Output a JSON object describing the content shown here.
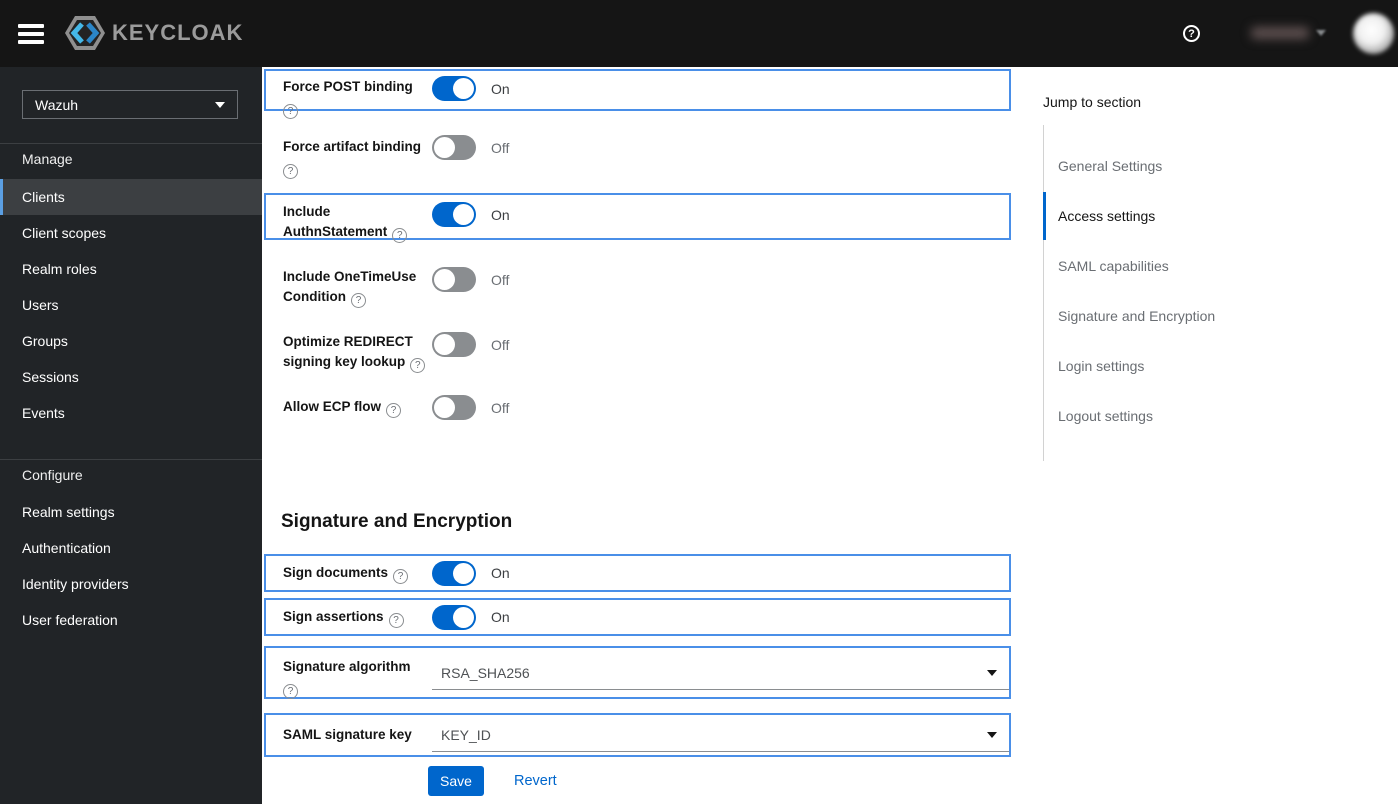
{
  "colors": {
    "accent_blue": "#0066cc",
    "highlight_border": "#4a8fe8",
    "sidebar_active_bar": "#5b9fe3",
    "masthead_bg": "#151515",
    "sidebar_bg": "#212427"
  },
  "masthead": {
    "brand": "KEYCLOAK",
    "help_icon": "question-circle-icon",
    "help_glyph": "?"
  },
  "sidebar": {
    "realm": "Wazuh",
    "manage_label": "Manage",
    "manage_items": [
      "Clients",
      "Client scopes",
      "Realm roles",
      "Users",
      "Groups",
      "Sessions",
      "Events"
    ],
    "active_item": "Clients",
    "configure_label": "Configure",
    "configure_items": [
      "Realm settings",
      "Authentication",
      "Identity providers",
      "User federation"
    ]
  },
  "form": {
    "toggle_rows": [
      {
        "label": "Force POST binding",
        "state": "On",
        "highlighted": true
      },
      {
        "label": "Force artifact binding",
        "state": "Off",
        "highlighted": false
      },
      {
        "label": "Include AuthnStatement",
        "state": "On",
        "highlighted": true
      },
      {
        "label": "Include OneTimeUse Condition",
        "state": "Off",
        "highlighted": false
      },
      {
        "label": "Optimize REDIRECT signing key lookup",
        "state": "Off",
        "highlighted": false
      },
      {
        "label": "Allow ECP flow",
        "state": "Off",
        "highlighted": false
      }
    ],
    "section_heading": "Signature and Encryption",
    "signature_toggle_rows": [
      {
        "label": "Sign documents",
        "state": "On",
        "highlighted": true
      },
      {
        "label": "Sign assertions",
        "state": "On",
        "highlighted": true
      }
    ],
    "select_rows": [
      {
        "label": "Signature algorithm",
        "value": "RSA_SHA256",
        "highlighted": true
      },
      {
        "label": "SAML signature key",
        "value": "KEY_ID",
        "highlighted": true
      }
    ],
    "save_label": "Save",
    "revert_label": "Revert",
    "help_glyph": "?"
  },
  "jump_nav": {
    "title": "Jump to section",
    "items": [
      "General Settings",
      "Access settings",
      "SAML capabilities",
      "Signature and Encryption",
      "Login settings",
      "Logout settings"
    ],
    "active_item": "Access settings"
  }
}
